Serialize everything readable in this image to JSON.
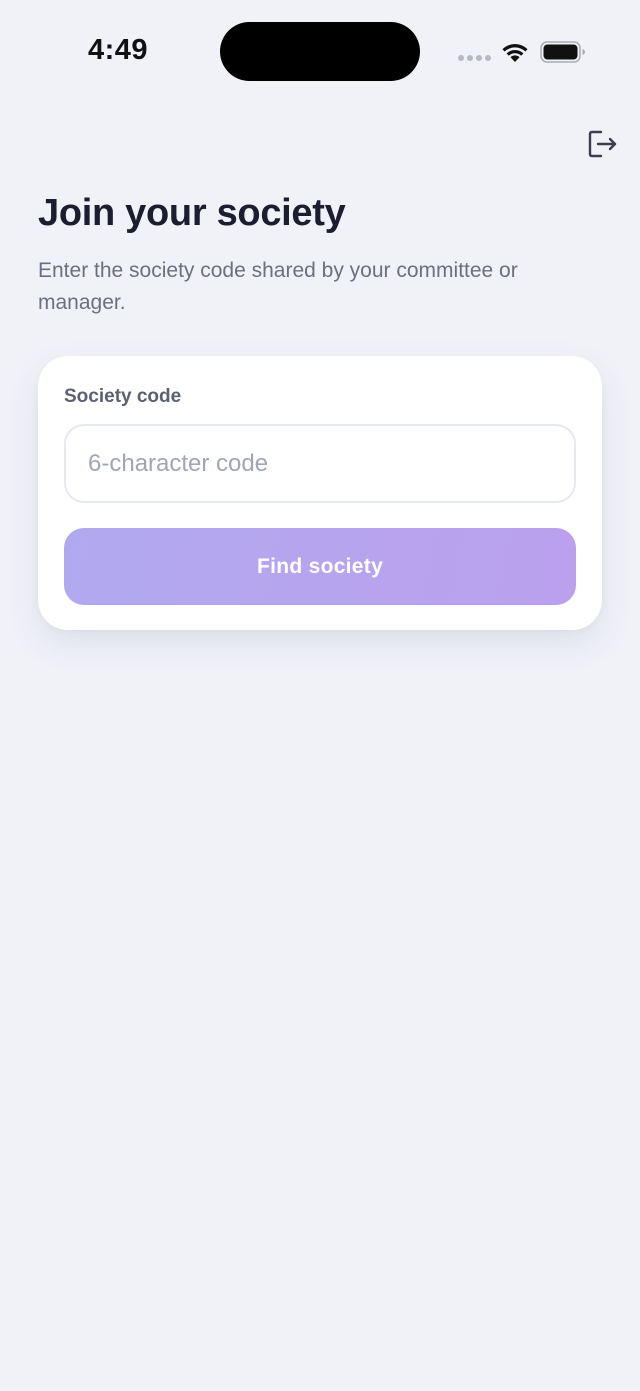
{
  "status_bar": {
    "time": "4:49",
    "icons": [
      "signal-dots-icon",
      "wifi-icon",
      "battery-icon"
    ]
  },
  "header": {
    "action_icon": "logout-icon"
  },
  "main": {
    "title": "Join your society",
    "subtitle": "Enter the society code shared by your committee or manager."
  },
  "form": {
    "code_label": "Society code",
    "code_value": "",
    "code_placeholder": "6-character code",
    "submit_label": "Find society",
    "submit_enabled": false
  },
  "colors": {
    "background": "#f1f2f8",
    "card": "#ffffff",
    "title": "#1c1d2e",
    "subtitle": "#6c6f80",
    "button_gradient_start": "#b1a9ef",
    "button_gradient_end": "#bba0ee"
  }
}
